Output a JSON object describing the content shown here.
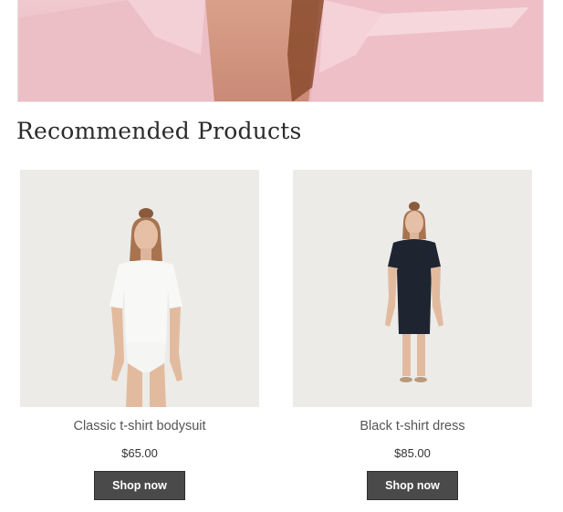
{
  "section": {
    "title": "Recommended Products"
  },
  "products": [
    {
      "name": "Classic t-shirt bodysuit",
      "price": "$65.00",
      "button_label": "Shop now"
    },
    {
      "name": "Black t-shirt dress",
      "price": "$85.00",
      "button_label": "Shop now"
    }
  ],
  "colors": {
    "hero_pink": "#efc6cc",
    "product_bg": "#ecebe8",
    "button_bg": "#4a4a4a",
    "button_text": "#ffffff"
  }
}
